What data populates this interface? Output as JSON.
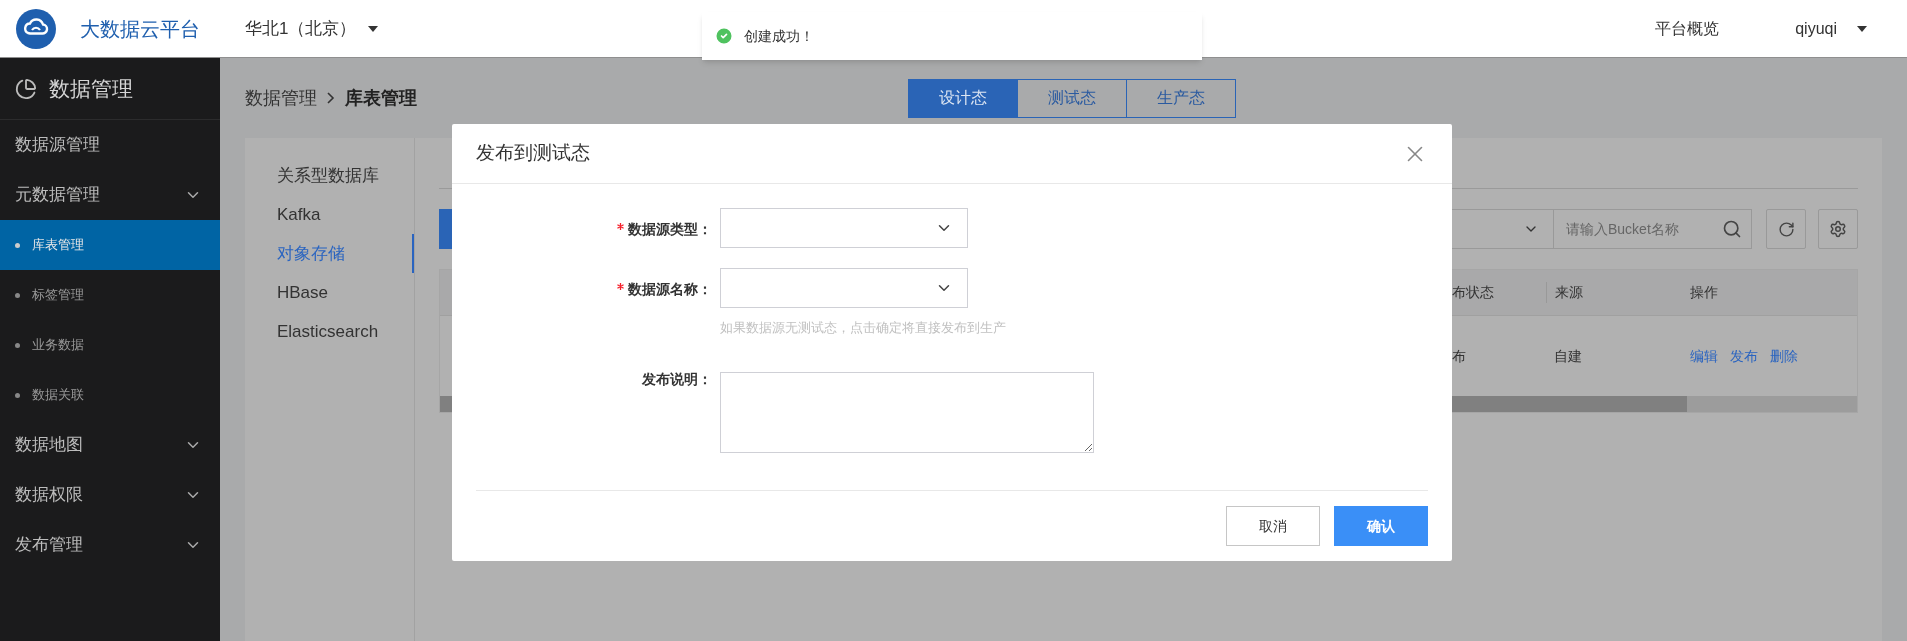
{
  "header": {
    "brand": "大数据云平台",
    "region": "华北1（北京）",
    "nav_link": "平台概览",
    "user": "qiyuqi"
  },
  "toast": {
    "message": "创建成功！"
  },
  "sidebar": {
    "title": "数据管理",
    "items": [
      {
        "kind": "link",
        "label": "数据源管理",
        "selected": false
      },
      {
        "kind": "group",
        "label": "元数据管理",
        "selected": false,
        "children": [
          {
            "label": "库表管理",
            "selected": true
          },
          {
            "label": "标签管理",
            "selected": false
          },
          {
            "label": "业务数据",
            "selected": false
          },
          {
            "label": "数据关联",
            "selected": false
          }
        ]
      },
      {
        "kind": "group",
        "label": "数据地图",
        "selected": false
      },
      {
        "kind": "group",
        "label": "数据权限",
        "selected": false
      },
      {
        "kind": "group",
        "label": "发布管理",
        "selected": false
      }
    ]
  },
  "breadcrumb": [
    "数据管理",
    "库表管理"
  ],
  "env_tabs": [
    {
      "label": "设计态",
      "selected": true
    },
    {
      "label": "测试态",
      "selected": false
    },
    {
      "label": "生产态",
      "selected": false
    }
  ],
  "category_nav": [
    {
      "label": "关系型数据库",
      "selected": false
    },
    {
      "label": "Kafka",
      "selected": false
    },
    {
      "label": "对象存储",
      "selected": true
    },
    {
      "label": "HBase",
      "selected": false
    },
    {
      "label": "Elasticsearch",
      "selected": false
    }
  ],
  "toolbar": {
    "search_placeholder": "请输入Bucket名称"
  },
  "table": {
    "columns": [
      "布状态",
      "来源",
      "操作"
    ],
    "rows": [
      {
        "cells": [
          "布",
          "自建"
        ],
        "actions": [
          "编辑",
          "发布",
          "删除"
        ]
      }
    ]
  },
  "dialog": {
    "title": "发布到测试态",
    "fields": [
      {
        "kind": "select",
        "label": "数据源类型：",
        "required": true
      },
      {
        "kind": "select",
        "label": "数据源名称：",
        "required": true,
        "hint": "如果数据源无测试态，点击确定将直接发布到生产"
      },
      {
        "kind": "textarea",
        "label": "发布说明：",
        "required": false
      }
    ],
    "buttons": [
      {
        "kind": "default",
        "label": "取消"
      },
      {
        "kind": "primary",
        "label": "确认"
      }
    ]
  }
}
